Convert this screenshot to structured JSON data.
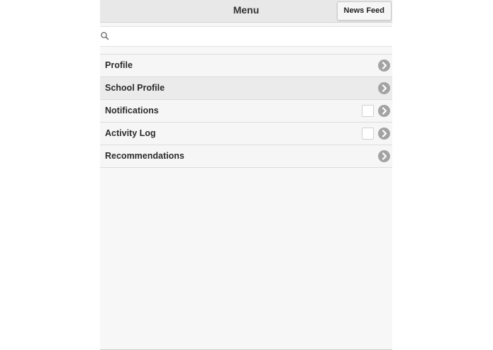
{
  "header": {
    "title": "Menu",
    "news_feed_label": "News Feed"
  },
  "search": {
    "icon": "search-icon",
    "value": "",
    "placeholder": ""
  },
  "menu": {
    "items": [
      {
        "id": "profile",
        "label": "Profile",
        "has_checkbox": false,
        "checked": false,
        "active": false,
        "icon": "chevron-right-icon"
      },
      {
        "id": "school-profile",
        "label": "School Profile",
        "has_checkbox": false,
        "checked": false,
        "active": true,
        "icon": "chevron-right-icon"
      },
      {
        "id": "notifications",
        "label": "Notifications",
        "has_checkbox": true,
        "checked": false,
        "active": false,
        "icon": "chevron-right-icon"
      },
      {
        "id": "activity-log",
        "label": "Activity Log",
        "has_checkbox": true,
        "checked": false,
        "active": false,
        "icon": "chevron-right-icon"
      },
      {
        "id": "recommendations",
        "label": "Recommendations",
        "has_checkbox": false,
        "checked": false,
        "active": false,
        "icon": "chevron-right-icon"
      }
    ]
  },
  "colors": {
    "header_bg": "#e8e8e8",
    "panel_bg": "#f7f7f7",
    "active_row_bg": "#ebebeb",
    "chevron_bg": "#a3a3a3"
  }
}
